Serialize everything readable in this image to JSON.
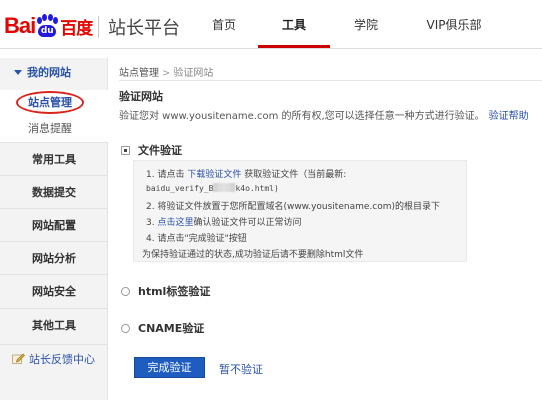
{
  "header": {
    "logo_bai": "Bai",
    "logo_du": "du",
    "logo_cn": "百度",
    "site_title": "站长平台",
    "nav": [
      {
        "label": "首页"
      },
      {
        "label": "工具"
      },
      {
        "label": "学院"
      },
      {
        "label": "VIP俱乐部"
      }
    ]
  },
  "sidebar": {
    "group_title": "我的网站",
    "sub_items": [
      {
        "label": "站点管理"
      },
      {
        "label": "消息提醒"
      }
    ],
    "items": [
      {
        "label": "常用工具"
      },
      {
        "label": "数据提交"
      },
      {
        "label": "网站配置"
      },
      {
        "label": "网站分析"
      },
      {
        "label": "网站安全"
      },
      {
        "label": "其他工具"
      }
    ],
    "feedback": "站长反馈中心"
  },
  "main": {
    "breadcrumb": {
      "root": "站点管理",
      "sep": ">",
      "current": "验证网站"
    },
    "section_title": "验证网站",
    "description": "验证您对 www.yousitename.com 的所有权,您可以选择任意一种方式进行验证。",
    "help_link": "验证帮助",
    "options": [
      {
        "label": "文件验证",
        "selected": true
      },
      {
        "label": "html标签验证",
        "selected": false
      },
      {
        "label": "CNAME验证",
        "selected": false
      }
    ],
    "steps": {
      "s1_prefix": "1. 请点击",
      "s1_link": "下载验证文件",
      "s1_suffix": "获取验证文件（当前最新:",
      "filename_start": "baidu_verify_B",
      "filename_end": "k4o.html)",
      "s2": "2. 将验证文件放置于您所配置域名(www.yousitename.com)的根目录下",
      "s3_prefix": "3.",
      "s3_link": "点击这里",
      "s3_suffix": "确认验证文件可以正常访问",
      "s4": "4. 请点击\"完成验证\"按钮",
      "note": "为保持验证通过的状态,成功验证后请不要删除html文件"
    },
    "submit_button": "完成验证",
    "skip_link": "暂不验证"
  }
}
